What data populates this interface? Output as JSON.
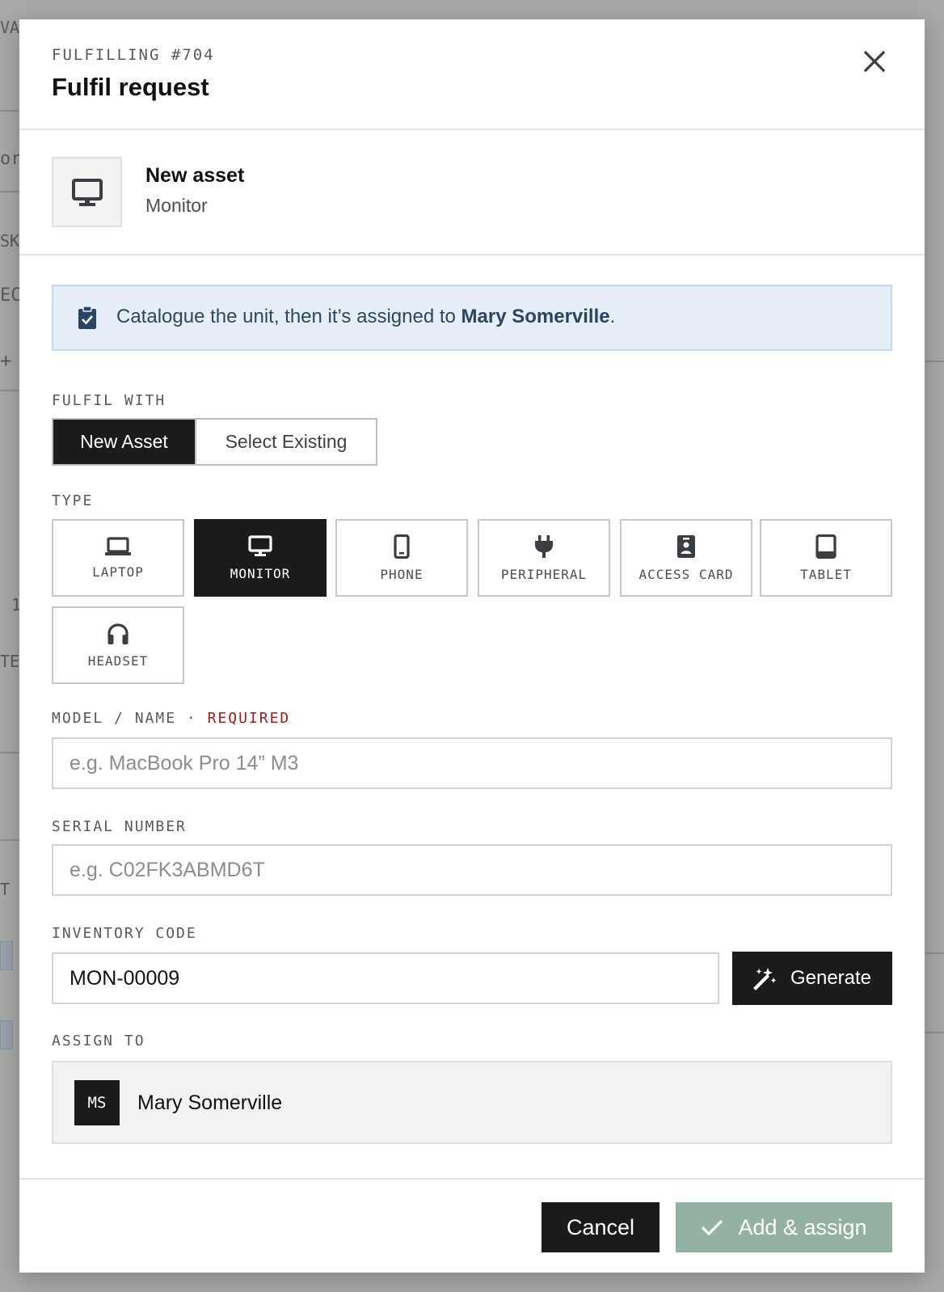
{
  "background": {
    "fragments": [
      "VA",
      "ort",
      "SK",
      "EC",
      "+",
      "1",
      "TE",
      "T"
    ]
  },
  "modal": {
    "eyebrow": "FULFILLING #704",
    "title": "Fulfil request",
    "close_icon": "close-icon"
  },
  "summary": {
    "icon": "monitor-icon",
    "title": "New asset",
    "subtitle": "Monitor"
  },
  "info": {
    "icon": "clipboard-check-icon",
    "text_before": "Catalogue the unit, then it’s assigned to ",
    "name": "Mary Somerville",
    "text_after": "."
  },
  "fulfil_with": {
    "label": "FULFIL WITH",
    "options": [
      "New Asset",
      "Select Existing"
    ],
    "selected": "New Asset"
  },
  "type": {
    "label": "TYPE",
    "options": [
      {
        "label": "LAPTOP",
        "icon": "laptop-icon"
      },
      {
        "label": "MONITOR",
        "icon": "monitor-icon"
      },
      {
        "label": "PHONE",
        "icon": "phone-icon"
      },
      {
        "label": "PERIPHERAL",
        "icon": "plug-icon"
      },
      {
        "label": "ACCESS CARD",
        "icon": "badge-icon"
      },
      {
        "label": "TABLET",
        "icon": "tablet-icon"
      },
      {
        "label": "HEADSET",
        "icon": "headset-icon"
      }
    ],
    "selected": "MONITOR"
  },
  "model": {
    "label": "MODEL / NAME",
    "separator": "·",
    "required": "REQUIRED",
    "placeholder": "e.g. MacBook Pro 14” M3",
    "value": ""
  },
  "serial": {
    "label": "SERIAL NUMBER",
    "placeholder": "e.g. C02FK3ABMD6T",
    "value": ""
  },
  "inventory": {
    "label": "INVENTORY CODE",
    "value": "MON-00009",
    "generate_label": "Generate",
    "generate_icon": "magic-wand-icon"
  },
  "assign": {
    "label": "ASSIGN TO",
    "initials": "MS",
    "name": "Mary Somerville"
  },
  "footer": {
    "cancel_label": "Cancel",
    "submit_label": "Add & assign",
    "submit_icon": "check-icon"
  },
  "colors": {
    "dark": "#1b1b1d",
    "info_bg": "#e6eef8",
    "required": "#9a2020",
    "submit_disabled": "#93b2a3"
  }
}
